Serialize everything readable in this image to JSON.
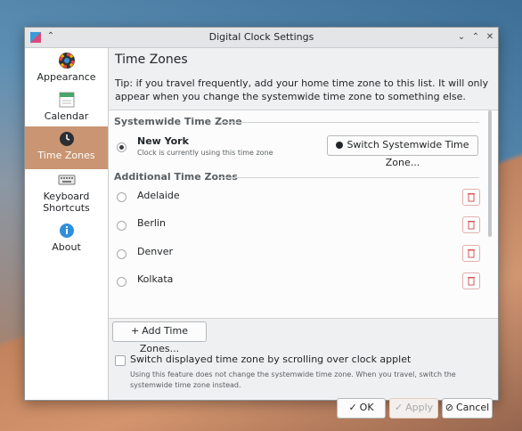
{
  "window": {
    "title": "Digital Clock Settings"
  },
  "sidebar": {
    "items": [
      {
        "label": "Appearance",
        "icon": "appearance-icon"
      },
      {
        "label": "Calendar",
        "icon": "calendar-icon"
      },
      {
        "label": "Time Zones",
        "icon": "clock-icon",
        "active": true
      },
      {
        "label": "Keyboard Shortcuts",
        "icon": "keyboard-icon"
      },
      {
        "label": "About",
        "icon": "info-icon"
      }
    ]
  },
  "main": {
    "title": "Time Zones",
    "tip": "Tip: if you travel frequently, add your home time zone to this list. It will only appear when you change the systemwide time zone to something else.",
    "systemwide": {
      "heading": "Systemwide Time Zone",
      "name": "New York",
      "subtitle": "Clock is currently using this time zone",
      "switch_button": "Switch Systemwide Time Zone..."
    },
    "additional": {
      "heading": "Additional Time Zones",
      "zones": [
        "Adelaide",
        "Berlin",
        "Denver",
        "Kolkata"
      ]
    },
    "add_button": "Add Time Zones...",
    "scroll_checkbox_label": "Switch displayed time zone by scrolling over clock applet",
    "scroll_note": "Using this feature does not change the systemwide time zone. When you travel, switch the systemwide time zone instead."
  },
  "footer": {
    "ok": "OK",
    "apply": "Apply",
    "cancel": "Cancel"
  },
  "colors": {
    "accent": "#c99572",
    "delete": "#d65a5a"
  }
}
